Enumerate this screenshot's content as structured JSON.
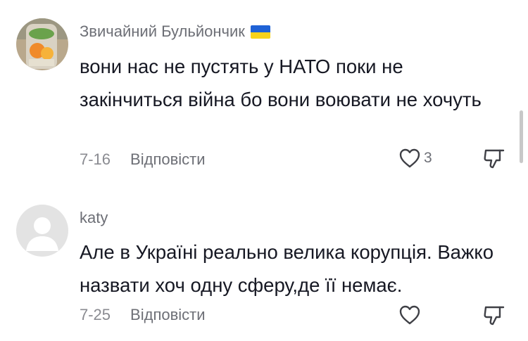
{
  "comments": [
    {
      "username": "Звичайний Бульйончик",
      "has_flag": true,
      "text": "вони нас не пустять у НАТО поки не закінчиться війна бо вони воювати не хочуть",
      "date": "7-16",
      "reply_label": "Відповісти",
      "like_count": "3"
    },
    {
      "username": "katy",
      "has_flag": false,
      "text": "Але в Україні реально велика корупція. Важко назвати хоч одну сферу,де її немає.",
      "date": "7-25",
      "reply_label": "Відповісти",
      "like_count": ""
    }
  ],
  "colors": {
    "username": "#6d6f76",
    "text": "#161823",
    "meta": "#8a8b91",
    "icon": "#3f4046",
    "flag_blue": "#1f62d6",
    "flag_yellow": "#f7d21b"
  },
  "icons": {
    "like": "heart-outline-icon",
    "dislike": "thumbs-down-outline-icon"
  }
}
